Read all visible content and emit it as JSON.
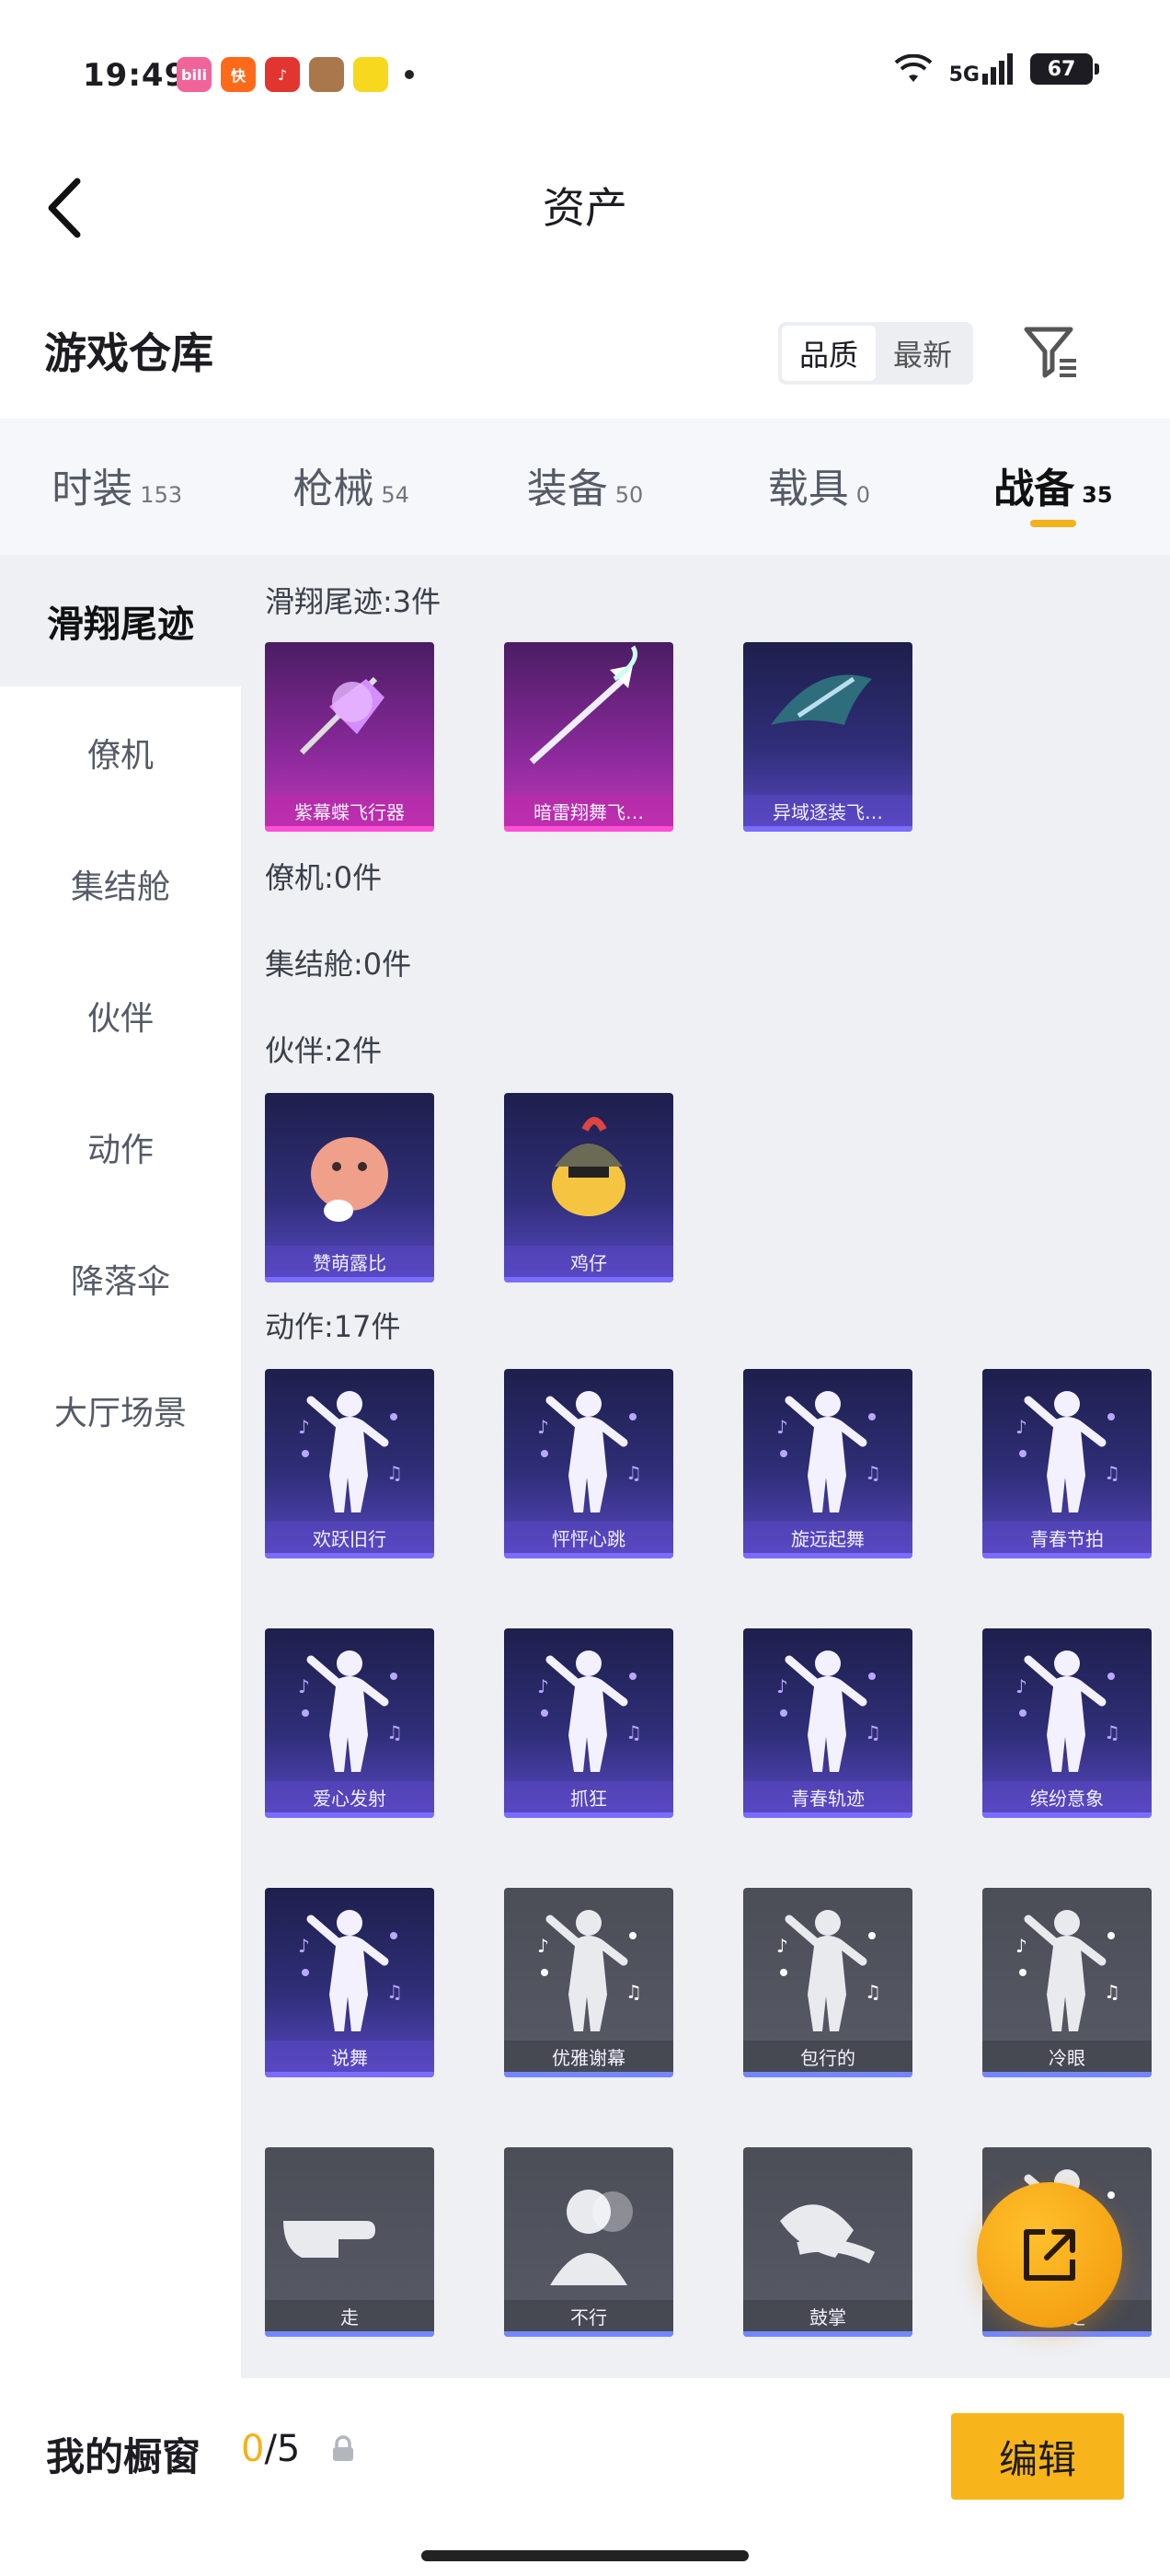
{
  "status_bar": {
    "time": "19:49",
    "apps": [
      {
        "icon": "bilibili-icon",
        "label": "bili",
        "color": "#f0649a"
      },
      {
        "icon": "kuaishou-icon",
        "label": "快",
        "color": "#ff6a1a"
      },
      {
        "icon": "music-icon",
        "label": "♪",
        "color": "#e2352f"
      },
      {
        "icon": "game-avatar-icon",
        "label": "",
        "color": "#a9774b"
      },
      {
        "icon": "meituan-icon",
        "label": "",
        "color": "#f8d81e"
      }
    ],
    "network": "5G",
    "battery": "67"
  },
  "header": {
    "title": "资产",
    "back_icon": "chevron-left-icon"
  },
  "section": {
    "title": "游戏仓库",
    "sort_options": [
      "品质",
      "最新"
    ],
    "sort_active": "品质",
    "filter_icon": "filter-icon"
  },
  "tabs": [
    {
      "label": "时装",
      "count": "153",
      "active": false
    },
    {
      "label": "枪械",
      "count": "54",
      "active": false
    },
    {
      "label": "装备",
      "count": "50",
      "active": false
    },
    {
      "label": "载具",
      "count": "0",
      "active": false
    },
    {
      "label": "战备",
      "count": "35",
      "active": true
    }
  ],
  "sidebar": [
    {
      "label": "滑翔尾迹",
      "active": true
    },
    {
      "label": "僚机",
      "active": false
    },
    {
      "label": "集结舱",
      "active": false
    },
    {
      "label": "伙伴",
      "active": false
    },
    {
      "label": "动作",
      "active": false
    },
    {
      "label": "降落伞",
      "active": false
    },
    {
      "label": "大厅场景",
      "active": false
    }
  ],
  "groups": {
    "trails": {
      "label": "滑翔尾迹:3件",
      "items": [
        {
          "name": "紫幕蝶飞行器",
          "quality": "pink",
          "icon": "butterfly-glider-icon"
        },
        {
          "name": "暗雷翔舞飞…",
          "quality": "pink",
          "icon": "arrow-glider-icon"
        },
        {
          "name": "异域逐装飞…",
          "quality": "purple",
          "icon": "winged-glider-icon"
        }
      ]
    },
    "wingman": {
      "label": "僚机:0件"
    },
    "capsule": {
      "label": "集结舱:0件"
    },
    "partners": {
      "label": "伙伴:2件",
      "items": [
        {
          "name": "赞萌露比",
          "quality": "purple",
          "icon": "capybara-icon"
        },
        {
          "name": "鸡仔",
          "quality": "purple",
          "icon": "chick-helmet-icon"
        }
      ]
    },
    "emotes": {
      "label": "动作:17件",
      "items": [
        {
          "name": "欢跃旧行",
          "quality": "purple",
          "icon": "dance-spin-icon"
        },
        {
          "name": "怦怦心跳",
          "quality": "purple",
          "icon": "dance-kick-icon"
        },
        {
          "name": "旋远起舞",
          "quality": "purple",
          "icon": "dance-wave-icon"
        },
        {
          "name": "青春节拍",
          "quality": "purple",
          "icon": "dance-pose-icon"
        },
        {
          "name": "爱心发射",
          "quality": "purple",
          "icon": "heart-shot-icon"
        },
        {
          "name": "抓狂",
          "quality": "purple",
          "icon": "frustrated-icon"
        },
        {
          "name": "青春轨迹",
          "quality": "purple",
          "icon": "dance-stretch-icon"
        },
        {
          "name": "缤纷意象",
          "quality": "purple",
          "icon": "sparkle-pose-icon"
        },
        {
          "name": "说舞",
          "quality": "purple",
          "icon": "dance-point-icon"
        },
        {
          "name": "优雅谢幕",
          "quality": "gray",
          "icon": "bow-icon"
        },
        {
          "name": "包行的",
          "quality": "gray",
          "icon": "raise-hand-icon"
        },
        {
          "name": "冷眼",
          "quality": "gray",
          "icon": "arms-crossed-icon"
        },
        {
          "name": "走",
          "quality": "gray",
          "icon": "point-hand-icon"
        },
        {
          "name": "不行",
          "quality": "gray",
          "icon": "head-shake-icon"
        },
        {
          "name": "鼓掌",
          "quality": "gray",
          "icon": "clap-icon"
        },
        {
          "name": "肯定",
          "quality": "gray",
          "icon": "nod-icon"
        }
      ]
    }
  },
  "float_button": {
    "icon": "share-external-icon"
  },
  "bottom_bar": {
    "label": "我的橱窗",
    "count_current": "0",
    "count_total": "/5",
    "lock_icon": "lock-icon",
    "edit_label": "编辑"
  }
}
